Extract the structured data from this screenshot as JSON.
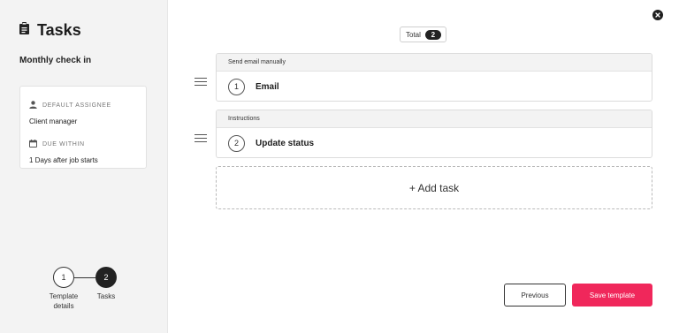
{
  "sidebar": {
    "title": "Tasks",
    "title_icon": "clipboard-icon",
    "template_name": "Monthly check in",
    "default_assignee_label": "DEFAULT ASSIGNEE",
    "default_assignee_value": "Client manager",
    "due_within_label": "DUE WITHIN",
    "due_within_value": "1 Days after job starts"
  },
  "stepper": {
    "steps": [
      {
        "number": "1",
        "label": "Template details",
        "active": false
      },
      {
        "number": "2",
        "label": "Tasks",
        "active": true
      }
    ]
  },
  "main": {
    "total_label": "Total",
    "total_count": "2",
    "tasks": [
      {
        "type": "Send email manually",
        "number": "1",
        "name": "Email"
      },
      {
        "type": "Instructions",
        "number": "2",
        "name": "Update status"
      }
    ],
    "add_task_label": "+ Add task"
  },
  "footer": {
    "previous_label": "Previous",
    "save_label": "Save template"
  },
  "colors": {
    "accent": "#f0275b",
    "sidebar_bg": "#f3f3f3",
    "dark": "#222222"
  }
}
